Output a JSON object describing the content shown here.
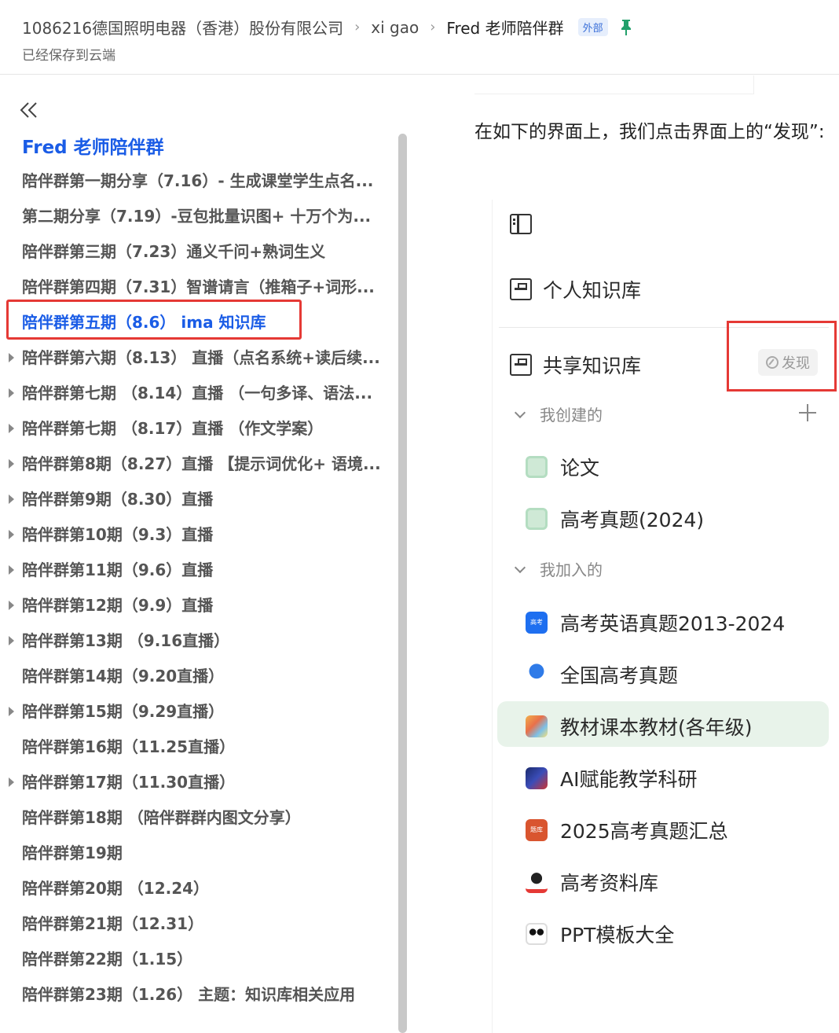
{
  "header": {
    "breadcrumbs": [
      "1086216德国照明电器（香港）股份有限公司",
      "xi gao",
      "Fred 老师陪伴群"
    ],
    "badge": "外部",
    "saved_status": "已经保存到云端",
    "icons": {
      "pin": "pin-icon",
      "separator": "chevron-right-icon"
    },
    "colors": {
      "pin": "#22a06b",
      "badge_text": "#3a6fd8"
    }
  },
  "sidebar": {
    "title": "Fred 老师陪伴群",
    "collapse_icon": "double-chevron-left-icon",
    "items": [
      {
        "label": "陪伴群第一期分享（7.16）- 生成课堂学生点名...",
        "expandable": false
      },
      {
        "label": "第二期分享（7.19）-豆包批量识图+ 十万个为...",
        "expandable": false
      },
      {
        "label": "陪伴群第三期（7.23）通义千问+熟词生义",
        "expandable": false
      },
      {
        "label": "陪伴群第四期（7.31）智谱请言（推箱子+词形...",
        "expandable": false
      },
      {
        "label": "陪伴群第五期（8.6） ima 知识库",
        "expandable": false,
        "active": true
      },
      {
        "label": "陪伴群第六期（8.13） 直播（点名系统+读后续...",
        "expandable": true
      },
      {
        "label": "陪伴群第七期 （8.14）直播 （一句多译、语法...",
        "expandable": true
      },
      {
        "label": "陪伴群第七期 （8.17）直播 （作文学案）",
        "expandable": true
      },
      {
        "label": "陪伴群第8期（8.27）直播 【提示词优化+ 语境...",
        "expandable": true
      },
      {
        "label": "陪伴群第9期（8.30）直播",
        "expandable": true
      },
      {
        "label": "陪伴群第10期（9.3）直播",
        "expandable": true
      },
      {
        "label": "陪伴群第11期（9.6）直播",
        "expandable": true
      },
      {
        "label": "陪伴群第12期（9.9）直播",
        "expandable": true
      },
      {
        "label": "陪伴群第13期 （9.16直播）",
        "expandable": true
      },
      {
        "label": "陪伴群第14期（9.20直播）",
        "expandable": false
      },
      {
        "label": "陪伴群第15期（9.29直播）",
        "expandable": true
      },
      {
        "label": "陪伴群第16期（11.25直播）",
        "expandable": false
      },
      {
        "label": "陪伴群第17期（11.30直播）",
        "expandable": true
      },
      {
        "label": "陪伴群第18期 （陪伴群群内图文分享）",
        "expandable": false
      },
      {
        "label": "陪伴群第19期",
        "expandable": false
      },
      {
        "label": "陪伴群第20期 （12.24）",
        "expandable": false
      },
      {
        "label": "陪伴群第21期（12.31）",
        "expandable": false
      },
      {
        "label": "陪伴群第22期（1.15）",
        "expandable": false
      },
      {
        "label": "陪伴群第23期（1.26） 主题：知识库相关应用",
        "expandable": false
      }
    ],
    "colors": {
      "active": "#1a5ce6",
      "highlight_border": "#e53935"
    }
  },
  "content": {
    "paragraph": "在如下的界面上，我们点击界面上的“发现”:",
    "screenshot": {
      "toggle_icon": "sidebar-toggle-icon",
      "personal_kb": "个人知识库",
      "shared_kb": "共享知识库",
      "discover": "发现",
      "group_created": "我创建的",
      "group_joined": "我加入的",
      "created_items": [
        "论文",
        "高考真题(2024)"
      ],
      "joined_items": [
        "高考英语真题2013-2024",
        "全国高考真题",
        "教材课本教材(各年级)",
        "AI赋能教学科研",
        "2025高考真题汇总",
        "高考资料库",
        "PPT模板大全"
      ],
      "icon_labels": {
        "blue_badge": "高考",
        "red_badge": "题库"
      },
      "selected_item": "教材课本教材(各年级)"
    }
  }
}
